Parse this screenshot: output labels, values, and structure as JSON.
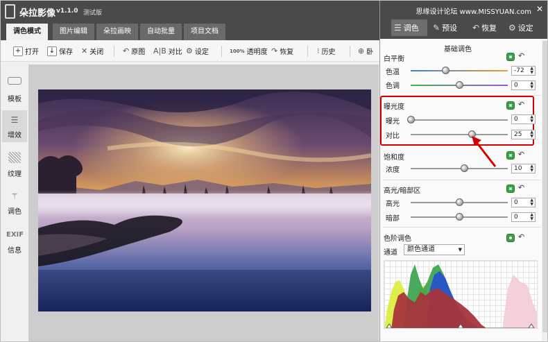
{
  "app": {
    "title": "朵拉影像",
    "version": "v1.1.0",
    "edition": "测试版"
  },
  "tabs": [
    {
      "label": "调色模式"
    },
    {
      "label": "图片编辑"
    },
    {
      "label": "朵拉画映"
    },
    {
      "label": "自动批量"
    },
    {
      "label": "项目文档"
    }
  ],
  "toolbar": {
    "open": "打开",
    "save": "保存",
    "close": "关闭",
    "original": "原图",
    "compare_glyph": "A|B",
    "compare": "对比",
    "settings": "设定",
    "opacity_badge": "100%",
    "opacity": "透明度",
    "restore": "恢复",
    "history": "历史",
    "more": "卧"
  },
  "sidebar": [
    {
      "label": "模板"
    },
    {
      "label": "增效"
    },
    {
      "label": "纹理"
    },
    {
      "label": "调色"
    },
    {
      "label": "信息",
      "icon_text": "EXIF"
    }
  ],
  "panel": {
    "watermark": "思缘设计论坛 www.MISSYUAN.com",
    "tabs": {
      "adjust": "调色",
      "presets": "预设",
      "restore": "恢复",
      "settings": "设定"
    },
    "section_title": "基础调色",
    "white_balance": {
      "title": "白平衡",
      "temp_label": "色温",
      "temp_value": "-72",
      "temp_position": 0.36,
      "tint_label": "色调",
      "tint_value": "0",
      "tint_position": 0.5
    },
    "exposure": {
      "title": "曝光度",
      "exposure_label": "曝光",
      "exposure_value": "0",
      "exposure_position": 0.0,
      "contrast_label": "对比",
      "contrast_value": "25",
      "contrast_position": 0.63
    },
    "saturation": {
      "title": "饱和度",
      "density_label": "浓度",
      "density_value": "10",
      "density_position": 0.55
    },
    "highlights": {
      "title": "高光/暗部区",
      "high_label": "高光",
      "high_value": "0",
      "high_position": 0.5,
      "shadow_label": "暗部",
      "shadow_value": "0",
      "shadow_position": 0.5
    },
    "levels": {
      "title": "色阶调色",
      "channel_label": "通道",
      "channel_value": "颜色通道"
    }
  },
  "colors": {
    "titlebar": "#4a4a4a",
    "highlight_box": "#d40000",
    "toggle_green": "#3aa14a"
  },
  "icons": [
    "logo-icon",
    "plus-icon",
    "down-arrow-icon",
    "close-icon",
    "undo-icon",
    "gear-icon",
    "restore-icon",
    "history-icon",
    "sliders-icon",
    "brush-icon"
  ]
}
